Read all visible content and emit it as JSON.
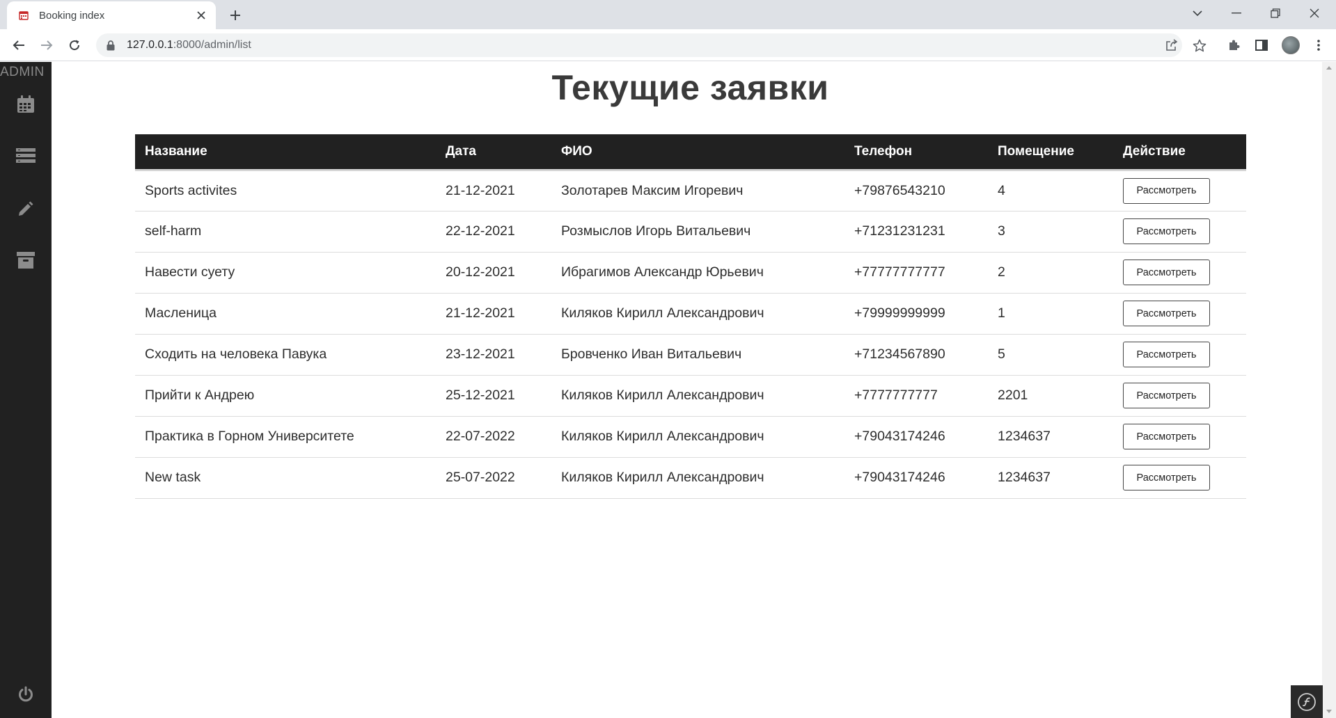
{
  "browser": {
    "tab_title": "Booking index",
    "url_host": "127.0.0.1",
    "url_rest": ":8000/admin/list"
  },
  "sidebar": {
    "brand": "ADMIN",
    "items": [
      {
        "icon": "calendar-icon"
      },
      {
        "icon": "list-icon"
      },
      {
        "icon": "pencil-icon"
      },
      {
        "icon": "archive-icon"
      }
    ],
    "bottom_icon": "power-icon"
  },
  "page": {
    "title": "Текущие заявки"
  },
  "table": {
    "headers": [
      "Название",
      "Дата",
      "ФИО",
      "Телефон",
      "Помещение",
      "Действие"
    ],
    "action_label": "Рассмотреть",
    "rows": [
      {
        "name": "Sports activites",
        "date": "21-12-2021",
        "fio": "Золотарев Максим Игоревич",
        "phone": "+79876543210",
        "room": "4"
      },
      {
        "name": "self-harm",
        "date": "22-12-2021",
        "fio": "Розмыслов Игорь Витальевич",
        "phone": "+71231231231",
        "room": "3"
      },
      {
        "name": "Навести суету",
        "date": "20-12-2021",
        "fio": "Ибрагимов Александр Юрьевич",
        "phone": "+77777777777",
        "room": "2"
      },
      {
        "name": "Масленица",
        "date": "21-12-2021",
        "fio": "Киляков Кирилл Александрович",
        "phone": "+79999999999",
        "room": "1"
      },
      {
        "name": "Сходить на человека Павука",
        "date": "23-12-2021",
        "fio": "Бровченко Иван Витальевич",
        "phone": "+71234567890",
        "room": "5"
      },
      {
        "name": "Прийти к Андрею",
        "date": "25-12-2021",
        "fio": "Киляков Кирилл Александрович",
        "phone": "+7777777777",
        "room": "2201"
      },
      {
        "name": "Практика в Горном Университете",
        "date": "22-07-2022",
        "fio": "Киляков Кирилл Александрович",
        "phone": "+79043174246",
        "room": "1234637"
      },
      {
        "name": "New task",
        "date": "25-07-2022",
        "fio": "Киляков Кирилл Александрович",
        "phone": "+79043174246",
        "room": "1234637"
      }
    ]
  },
  "colors": {
    "sidebar_bg": "#212121",
    "header_bg": "#212121",
    "title_text": "#3a3a3a"
  }
}
